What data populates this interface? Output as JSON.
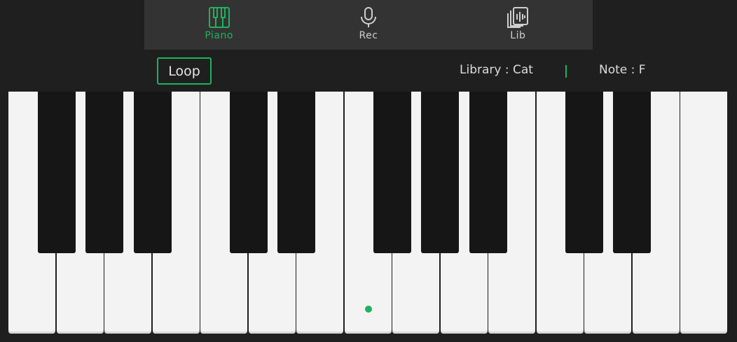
{
  "tabs": [
    {
      "id": "piano",
      "label": "Piano",
      "icon": "piano-icon",
      "active": true
    },
    {
      "id": "rec",
      "label": "Rec",
      "icon": "microphone-icon",
      "active": false
    },
    {
      "id": "lib",
      "label": "Lib",
      "icon": "library-icon",
      "active": false
    }
  ],
  "controls": {
    "loop_label": "Loop",
    "library_text": "Library : Cat",
    "note_text": "Note : F"
  },
  "keyboard": {
    "white_key_count": 15,
    "black_key_count": 10,
    "marker": "middle-c"
  },
  "colors": {
    "accent": "#1db35e",
    "background": "#1f1f1f",
    "tabbar": "#333333",
    "white_key": "#f3f3f3",
    "black_key": "#161616"
  }
}
